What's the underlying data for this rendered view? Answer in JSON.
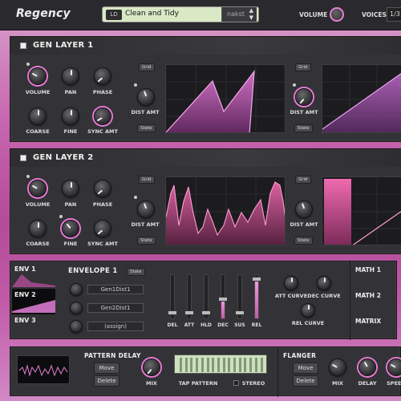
{
  "header": {
    "brand": "Regency",
    "preset_badge": "LD",
    "preset_name": "Clean and Tidy",
    "preset_author": "nakst",
    "volume_label": "VOLUME",
    "voices_label": "VOICES",
    "voices_value": "1/3"
  },
  "gen1": {
    "title": "GEN LAYER 1",
    "knobs": {
      "volume": "VOLUME",
      "pan": "PAN",
      "phase": "PHASE",
      "coarse": "COARSE",
      "fine": "FINE",
      "sync_amt": "SYNC AMT"
    },
    "grid": "Grid",
    "dist_amt": "DIST AMT",
    "state": "State",
    "grid2": "Grid",
    "dist_amt2": "DIST AMT",
    "state2": "State"
  },
  "gen2": {
    "title": "GEN LAYER 2",
    "knobs": {
      "volume": "VOLUME",
      "pan": "PAN",
      "phase": "PHASE",
      "coarse": "COARSE",
      "fine": "FINE",
      "sync_amt": "SYNC AMT"
    },
    "grid": "Grid",
    "dist_amt": "DIST AMT",
    "state": "State",
    "grid2": "Grid",
    "dist_amt2": "DIST AMT",
    "state2": "State"
  },
  "env": {
    "tabs": [
      "ENV 1",
      "ENV 2",
      "ENV 3"
    ],
    "title": "ENVELOPE 1",
    "state": "State",
    "targets": [
      "Gen1Dist1",
      "Gen2Dist1",
      "(assign)"
    ],
    "sliders": [
      "DEL",
      "ATT",
      "HLD",
      "DEC",
      "SUS",
      "REL"
    ],
    "slider_levels": [
      0.15,
      0.15,
      0.15,
      0.45,
      0.15,
      0.9
    ],
    "att_curve": "ATT CURVE",
    "dec_curve": "DEC CURVE",
    "rel_curve": "REL CURVE",
    "math": [
      "MATH 1",
      "MATH 2",
      "MATRIX"
    ]
  },
  "fx": {
    "pattern_delay": "PATTERN DELAY",
    "move": "Move",
    "delete": "Delete",
    "mix": "MIX",
    "tap_pattern": "TAP PATTERN",
    "stereo": "STEREO",
    "flanger": "FLANGER",
    "move2": "Move",
    "delete2": "Delete",
    "mix2": "MIX",
    "delay": "DELAY",
    "speed": "SPEED"
  },
  "colors": {
    "accent": "#e57fd7",
    "preset_bg": "#d9e9c6",
    "tap_bg": "#cfe0bf"
  }
}
